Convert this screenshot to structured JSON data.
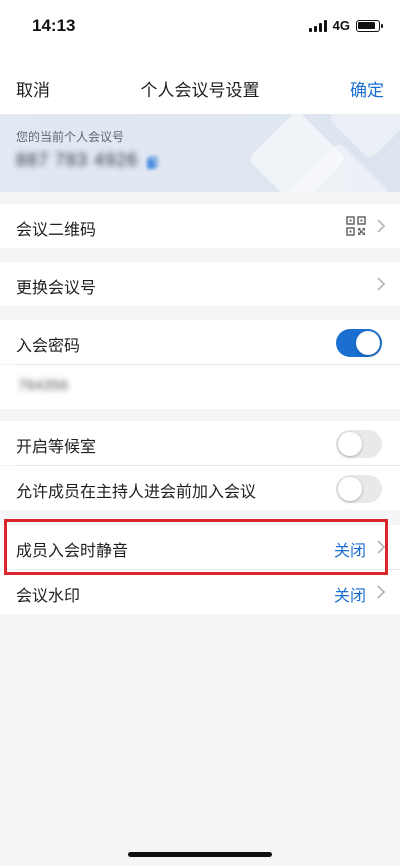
{
  "status_bar": {
    "time": "14:13",
    "network": "4G"
  },
  "nav": {
    "cancel": "取消",
    "title": "个人会议号设置",
    "confirm": "确定"
  },
  "meeting_id": {
    "label": "您的当前个人会议号",
    "value": "887 783 4926"
  },
  "rows": {
    "qr_code": {
      "label": "会议二维码"
    },
    "change_id": {
      "label": "更换会议号"
    },
    "password": {
      "label": "入会密码",
      "enabled": true,
      "value": "764356"
    },
    "waiting_room": {
      "label": "开启等候室",
      "enabled": false
    },
    "join_before_host": {
      "label": "允许成员在主持人进会前加入会议",
      "enabled": false
    },
    "mute_on_join": {
      "label": "成员入会时静音",
      "value": "关闭"
    },
    "watermark": {
      "label": "会议水印",
      "value": "关闭"
    }
  },
  "colors": {
    "accent": "#1b6fd1",
    "highlight": "#d9262c"
  }
}
